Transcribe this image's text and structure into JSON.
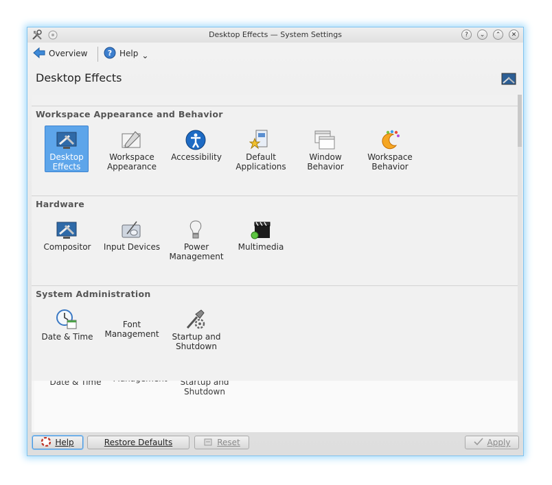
{
  "window": {
    "title": "Desktop Effects — System Settings"
  },
  "titlebar": {
    "buttons": [
      "?",
      "⌄",
      "⌃",
      "✕"
    ]
  },
  "toolbar": {
    "overview_label": "Overview",
    "help_label": "Help",
    "help_menu_glyph": "⌄"
  },
  "page": {
    "heading": "Desktop Effects"
  },
  "categories": [
    {
      "title": "Workspace Appearance and Behavior",
      "items": [
        {
          "label": "Desktop Effects",
          "icon": "desktop-effects-icon",
          "selected": true
        },
        {
          "label": "Workspace Appearance",
          "icon": "workspace-appearance-icon"
        },
        {
          "label": "Accessibility",
          "icon": "accessibility-icon"
        },
        {
          "label": "Default Applications",
          "icon": "default-applications-icon"
        },
        {
          "label": "Window Behavior",
          "icon": "window-behavior-icon"
        },
        {
          "label": "Workspace Behavior",
          "icon": "workspace-behavior-icon"
        }
      ]
    },
    {
      "title": "Hardware",
      "items": [
        {
          "label": "Compositor",
          "icon": "compositor-icon"
        },
        {
          "label": "Input Devices",
          "icon": "input-devices-icon"
        },
        {
          "label": "Power Management",
          "icon": "power-management-icon"
        },
        {
          "label": "Multimedia",
          "icon": "multimedia-icon"
        }
      ]
    },
    {
      "title": "System Administration",
      "items": [
        {
          "label": "Date & Time",
          "icon": "date-time-icon"
        },
        {
          "label": "Font Management",
          "icon": "font-management-icon"
        },
        {
          "label": "Startup and Shutdown",
          "icon": "startup-shutdown-icon"
        }
      ]
    }
  ],
  "ghost_items": [
    {
      "label": "Date & Time"
    },
    {
      "label": "Management"
    },
    {
      "label": "Startup and Shutdown"
    }
  ],
  "buttons": {
    "help": "Help",
    "restore_defaults": "Restore Defaults",
    "reset": "Reset",
    "apply": "Apply"
  },
  "colors": {
    "selection": "#5da5ea",
    "focus_ring": "#4b97dd",
    "window_glow": "#a9dcfb"
  }
}
